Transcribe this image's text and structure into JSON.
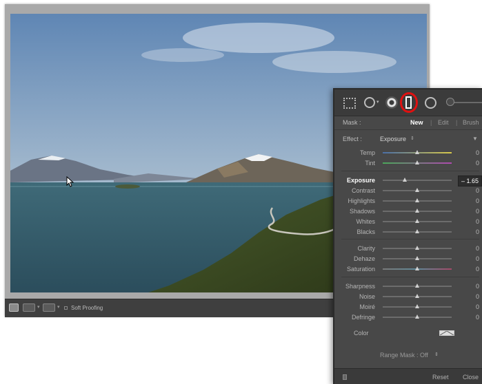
{
  "toolbar": {
    "soft_proofing_label": "Soft Proofing"
  },
  "icons": {
    "crop": "crop-overlay-icon",
    "spot": "spot-removal-icon",
    "redeye": "red-eye-icon",
    "graduated": "graduated-filter-icon",
    "radial": "radial-filter-icon",
    "brush": "adjustment-brush-icon"
  },
  "colors": {
    "highlight_ring": "#e01010",
    "panel_bg": "#484848",
    "toolbar_bg": "#3f3f3f"
  },
  "panel": {
    "mask_label": "Mask :",
    "mask_new": "New",
    "mask_edit": "Edit",
    "mask_brush": "Brush",
    "effect_label": "Effect :",
    "effect_value": "Exposure",
    "sliders": [
      {
        "label": "Temp",
        "value": "0",
        "position": 0.5
      },
      {
        "label": "Tint",
        "value": "0",
        "position": 0.5
      },
      {
        "label": "Exposure",
        "value": "– 1.65",
        "position": 0.32
      },
      {
        "label": "Contrast",
        "value": "0",
        "position": 0.5
      },
      {
        "label": "Highlights",
        "value": "0",
        "position": 0.5
      },
      {
        "label": "Shadows",
        "value": "0",
        "position": 0.5
      },
      {
        "label": "Whites",
        "value": "0",
        "position": 0.5
      },
      {
        "label": "Blacks",
        "value": "0",
        "position": 0.5
      },
      {
        "label": "Clarity",
        "value": "0",
        "position": 0.5
      },
      {
        "label": "Dehaze",
        "value": "0",
        "position": 0.5
      },
      {
        "label": "Saturation",
        "value": "0",
        "position": 0.5
      },
      {
        "label": "Sharpness",
        "value": "0",
        "position": 0.5
      },
      {
        "label": "Noise",
        "value": "0",
        "position": 0.5
      },
      {
        "label": "Moiré",
        "value": "0",
        "position": 0.5
      },
      {
        "label": "Defringe",
        "value": "0",
        "position": 0.5
      }
    ],
    "color_label": "Color",
    "range_mask_label": "Range Mask : Off",
    "reset_label": "Reset",
    "close_label": "Close"
  }
}
